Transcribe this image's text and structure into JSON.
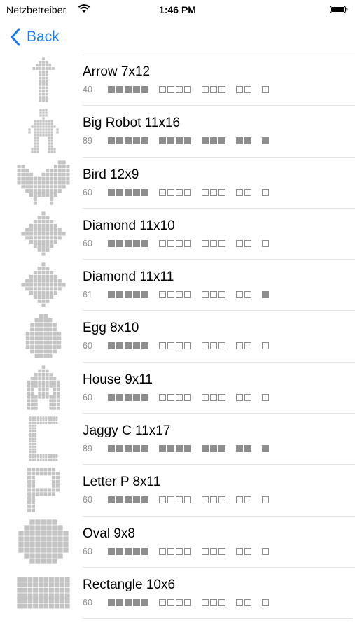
{
  "status": {
    "carrier": "Netzbetreiber",
    "time": "1:46 PM"
  },
  "nav": {
    "back_label": "Back"
  },
  "colors": {
    "accent": "#1a7cf4",
    "marker": "#8e8e8e",
    "thumb": "#c4c4c4",
    "separator": "#e4e4e4"
  },
  "puzzles": [
    {
      "name": "Arrow 7x12",
      "count": "40",
      "progress": [
        1,
        0,
        0,
        0,
        0
      ],
      "icon": "arrow"
    },
    {
      "name": "Big Robot 11x16",
      "count": "89",
      "progress": [
        1,
        1,
        1,
        1,
        1
      ],
      "icon": "robot"
    },
    {
      "name": "Bird 12x9",
      "count": "60",
      "progress": [
        1,
        0,
        0,
        0,
        0
      ],
      "icon": "bird"
    },
    {
      "name": "Diamond 11x10",
      "count": "60",
      "progress": [
        1,
        0,
        0,
        0,
        0
      ],
      "icon": "diamond"
    },
    {
      "name": "Diamond 11x11",
      "count": "61",
      "progress": [
        1,
        0,
        0,
        0,
        1
      ],
      "icon": "diamond"
    },
    {
      "name": "Egg 8x10",
      "count": "60",
      "progress": [
        1,
        0,
        0,
        0,
        0
      ],
      "icon": "egg"
    },
    {
      "name": "House 9x11",
      "count": "60",
      "progress": [
        1,
        0,
        0,
        0,
        0
      ],
      "icon": "house"
    },
    {
      "name": "Jaggy C 11x17",
      "count": "89",
      "progress": [
        1,
        1,
        1,
        1,
        1
      ],
      "icon": "jaggy-c"
    },
    {
      "name": "Letter P 8x11",
      "count": "60",
      "progress": [
        1,
        0,
        0,
        0,
        0
      ],
      "icon": "letter-p"
    },
    {
      "name": "Oval 9x8",
      "count": "60",
      "progress": [
        1,
        0,
        0,
        0,
        0
      ],
      "icon": "oval"
    },
    {
      "name": "Rectangle 10x6",
      "count": "60",
      "progress": [
        1,
        0,
        0,
        0,
        0
      ],
      "icon": "rectangle"
    }
  ]
}
